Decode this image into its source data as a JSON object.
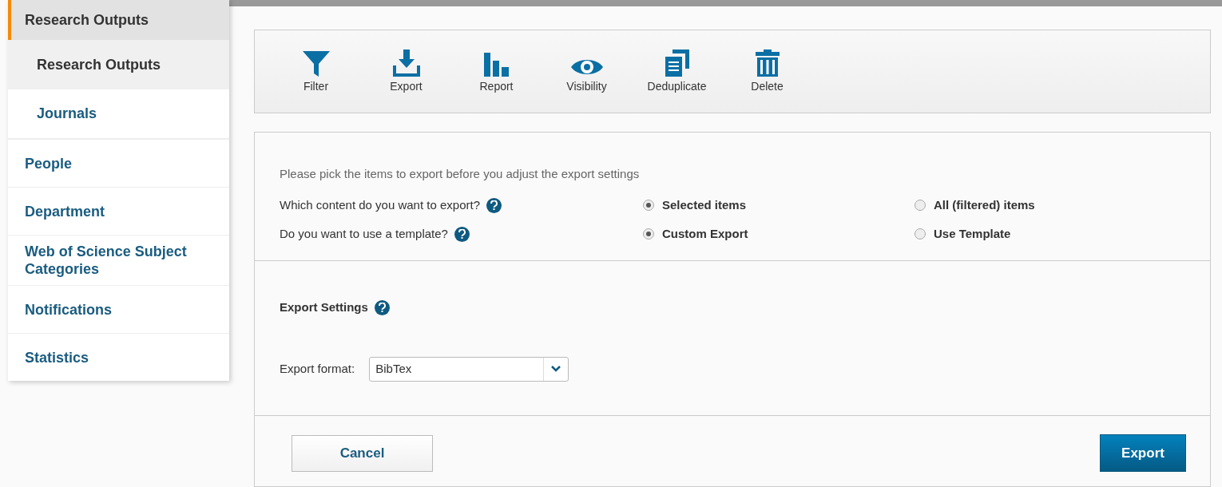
{
  "sidebar": {
    "items": [
      {
        "label": "Research Outputs",
        "selected": true,
        "expanded": true,
        "children": [
          {
            "label": "Research Outputs",
            "selected": true
          },
          {
            "label": "Journals",
            "selected": false
          }
        ]
      },
      {
        "label": "People",
        "selected": false
      },
      {
        "label": "Department",
        "selected": false
      },
      {
        "label": "Web of Science Subject Categories",
        "selected": false
      },
      {
        "label": "Notifications",
        "selected": false
      },
      {
        "label": "Statistics",
        "selected": false
      }
    ]
  },
  "toolbar": [
    {
      "kind": "filter",
      "label": "Filter"
    },
    {
      "kind": "export",
      "label": "Export"
    },
    {
      "kind": "report",
      "label": "Report"
    },
    {
      "kind": "visibility",
      "label": "Visibility"
    },
    {
      "kind": "deduplicate",
      "label": "Deduplicate"
    },
    {
      "kind": "delete",
      "label": "Delete"
    }
  ],
  "export_form": {
    "intro": "Please pick the items to export before you adjust the export settings",
    "questions": [
      {
        "label": "Which content do you want to export?",
        "options": [
          {
            "label": "Selected items",
            "selected": true
          },
          {
            "label": "All (filtered) items",
            "selected": false
          }
        ]
      },
      {
        "label": "Do you want to use a template?",
        "options": [
          {
            "label": "Custom Export",
            "selected": true
          },
          {
            "label": "Use Template",
            "selected": false
          }
        ]
      }
    ],
    "settings_title": "Export Settings",
    "format_label": "Export format:",
    "format_value": "BibTex",
    "cancel_button": "Cancel",
    "export_button": "Export"
  }
}
